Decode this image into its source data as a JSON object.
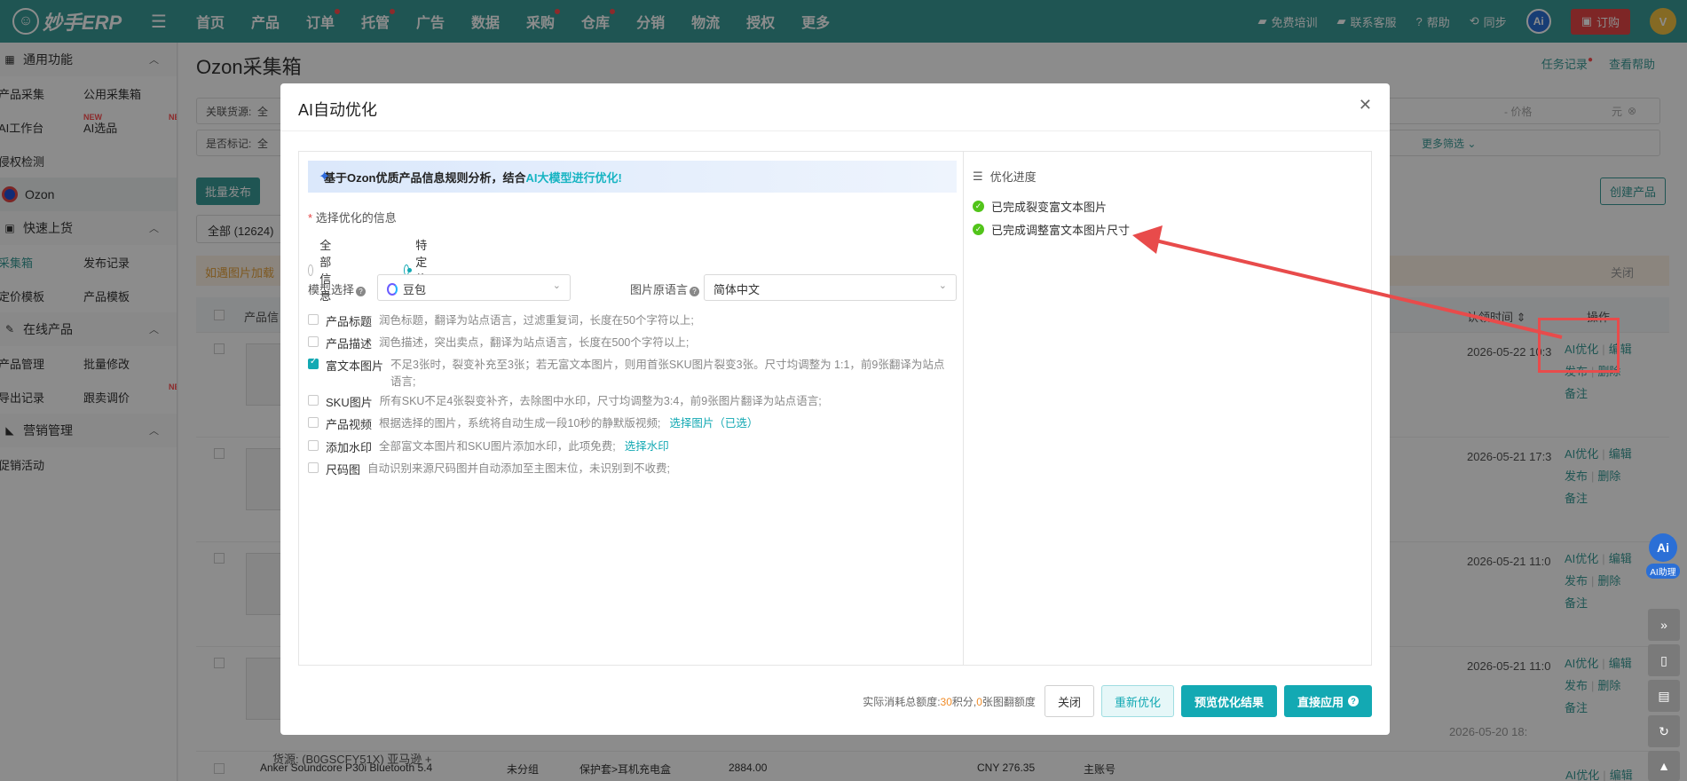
{
  "app": {
    "logo": "妙手ERP",
    "nav": [
      {
        "label": "首页",
        "dot": false
      },
      {
        "label": "产品",
        "dot": false
      },
      {
        "label": "订单",
        "dot": true
      },
      {
        "label": "托管",
        "dot": true
      },
      {
        "label": "广告",
        "dot": false
      },
      {
        "label": "数据",
        "dot": false
      },
      {
        "label": "采购",
        "dot": true
      },
      {
        "label": "仓库",
        "dot": true
      },
      {
        "label": "分销",
        "dot": false
      },
      {
        "label": "物流",
        "dot": false
      },
      {
        "label": "授权",
        "dot": false
      },
      {
        "label": "更多",
        "dot": false
      }
    ],
    "top_right": {
      "training": "免费培训",
      "support": "联系客服",
      "help": "帮助",
      "sync": "同步",
      "ai": "Ai",
      "order": "订购"
    }
  },
  "sidebar": {
    "group1": "通用功能",
    "row1": [
      "产品采集",
      "公用采集箱"
    ],
    "row2": [
      "AI工作台",
      "AI选品"
    ],
    "new_badge": "NEW",
    "row3": [
      "侵权检测"
    ],
    "ozon": "Ozon",
    "group2": "快速上货",
    "row4": [
      "采集箱",
      "发布记录"
    ],
    "row5": [
      "定价模板",
      "产品模板"
    ],
    "group3": "在线产品",
    "row6": [
      "产品管理",
      "批量修改"
    ],
    "row7": [
      "导出记录",
      "跟卖调价"
    ],
    "group4": "营销管理",
    "row8": [
      "促销活动"
    ]
  },
  "page": {
    "title": "Ozon采集箱",
    "links": {
      "tasks": "任务记录",
      "help": "查看帮助"
    },
    "filter1_label": "关联货源:",
    "filter1_hint": "全",
    "filter1_price": "- 价格",
    "filter1_unit": "元",
    "filter2_label": "是否标记:",
    "filter2_hint": "全",
    "more_filter": "更多筛选",
    "batch_publish": "批量发布",
    "create_product": "创建产品",
    "tab_all": "全部 (12624)",
    "warn": "如遇图片加载",
    "warn_close": "关闭",
    "col_product": "产品信",
    "col_time": "认领时间",
    "col_ops": "操作",
    "rows": [
      {
        "time": "2026-05-22 10:3"
      },
      {
        "time": "2026-05-21 17:3"
      },
      {
        "time": "2026-05-21 11:0"
      },
      {
        "time": "2026-05-21 11:0"
      },
      {
        "time": "2026-05-20 18:"
      }
    ],
    "ops": {
      "ai": "AI优化",
      "edit": "编辑",
      "publish": "发布",
      "delete": "删除",
      "note": "备注"
    },
    "partial_row": {
      "name": "Anker Soundcore P30i Bluetooth 5.4",
      "group": "未分组",
      "category": "保护套>耳机充电盒",
      "price": "2884.00",
      "cny": "CNY 276.35",
      "account": "主账号",
      "source": "货源: (B0GSCFY51X) 亚马逊 +"
    },
    "ai_helper": "AI助理"
  },
  "modal": {
    "title": "AI自动优化",
    "banner_prefix": "基于Ozon优质产品信息规则分析，结合",
    "banner_highlight": "AI大模型进行优化!",
    "select_label": "选择优化的信息",
    "radio_all": "全部信息",
    "radio_specific": "特定信息",
    "model_label": "模型选择",
    "model_value": "豆包",
    "lang_label": "图片原语言",
    "lang_value": "简体中文",
    "options": [
      {
        "name": "产品标题",
        "checked": false,
        "desc": "润色标题，翻译为站点语言，过滤重复词，长度在50个字符以上;",
        "link": ""
      },
      {
        "name": "产品描述",
        "checked": false,
        "desc": "润色描述，突出卖点，翻译为站点语言，长度在500个字符以上;",
        "link": ""
      },
      {
        "name": "富文本图片",
        "checked": true,
        "desc": "不足3张时，裂变补充至3张；若无富文本图片，则用首张SKU图片裂变3张。尺寸均调整为 1:1，前9张翻译为站点语言;",
        "link": ""
      },
      {
        "name": "SKU图片",
        "checked": false,
        "desc": "所有SKU不足4张裂变补齐，去除图中水印，尺寸均调整为3:4，前9张图片翻译为站点语言;",
        "link": ""
      },
      {
        "name": "产品视频",
        "checked": false,
        "desc": "根据选择的图片，系统将自动生成一段10秒的静默版视频;",
        "link": "选择图片（已选）"
      },
      {
        "name": "添加水印",
        "checked": false,
        "desc": "全部富文本图片和SKU图片添加水印，此项免费;",
        "link": "选择水印"
      },
      {
        "name": "尺码图",
        "checked": false,
        "desc": "自动识别来源尺码图并自动添加至主图末位，未识别到不收费;",
        "link": ""
      }
    ],
    "progress_title": "优化进度",
    "progress": [
      "已完成裂变富文本图片",
      "已完成调整富文本图片尺寸"
    ],
    "cost_prefix": "实际消耗总额度:",
    "cost_points": "30",
    "cost_points_unit": "积分,",
    "cost_trans": "0",
    "cost_trans_unit": "张图翻额度",
    "btn_close": "关闭",
    "btn_reoptimize": "重新优化",
    "btn_preview": "预览优化结果",
    "btn_apply": "直接应用"
  },
  "colors": {
    "brand": "#3a9c97",
    "accent": "#13a9b3",
    "annotation": "#e84b4b"
  }
}
